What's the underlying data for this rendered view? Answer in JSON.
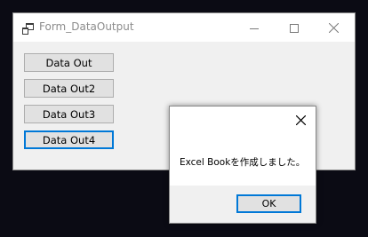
{
  "window": {
    "title": "Form_DataOutput",
    "icon": "app-window-icon",
    "controls": {
      "minimize": "minimize-icon",
      "maximize": "maximize-icon",
      "close": "close-icon"
    }
  },
  "buttons": [
    {
      "label": "Data Out"
    },
    {
      "label": "Data Out2"
    },
    {
      "label": "Data Out3"
    },
    {
      "label": "Data Out4",
      "focused": true
    }
  ],
  "message_box": {
    "message": "Excel Bookを作成しました。",
    "ok_label": "OK",
    "close_icon": "close-icon"
  },
  "colors": {
    "accent": "#0078d7",
    "window_bg": "#f0f0f0",
    "button_bg": "#e1e1e1",
    "desktop_bg": "#0b0b14"
  }
}
